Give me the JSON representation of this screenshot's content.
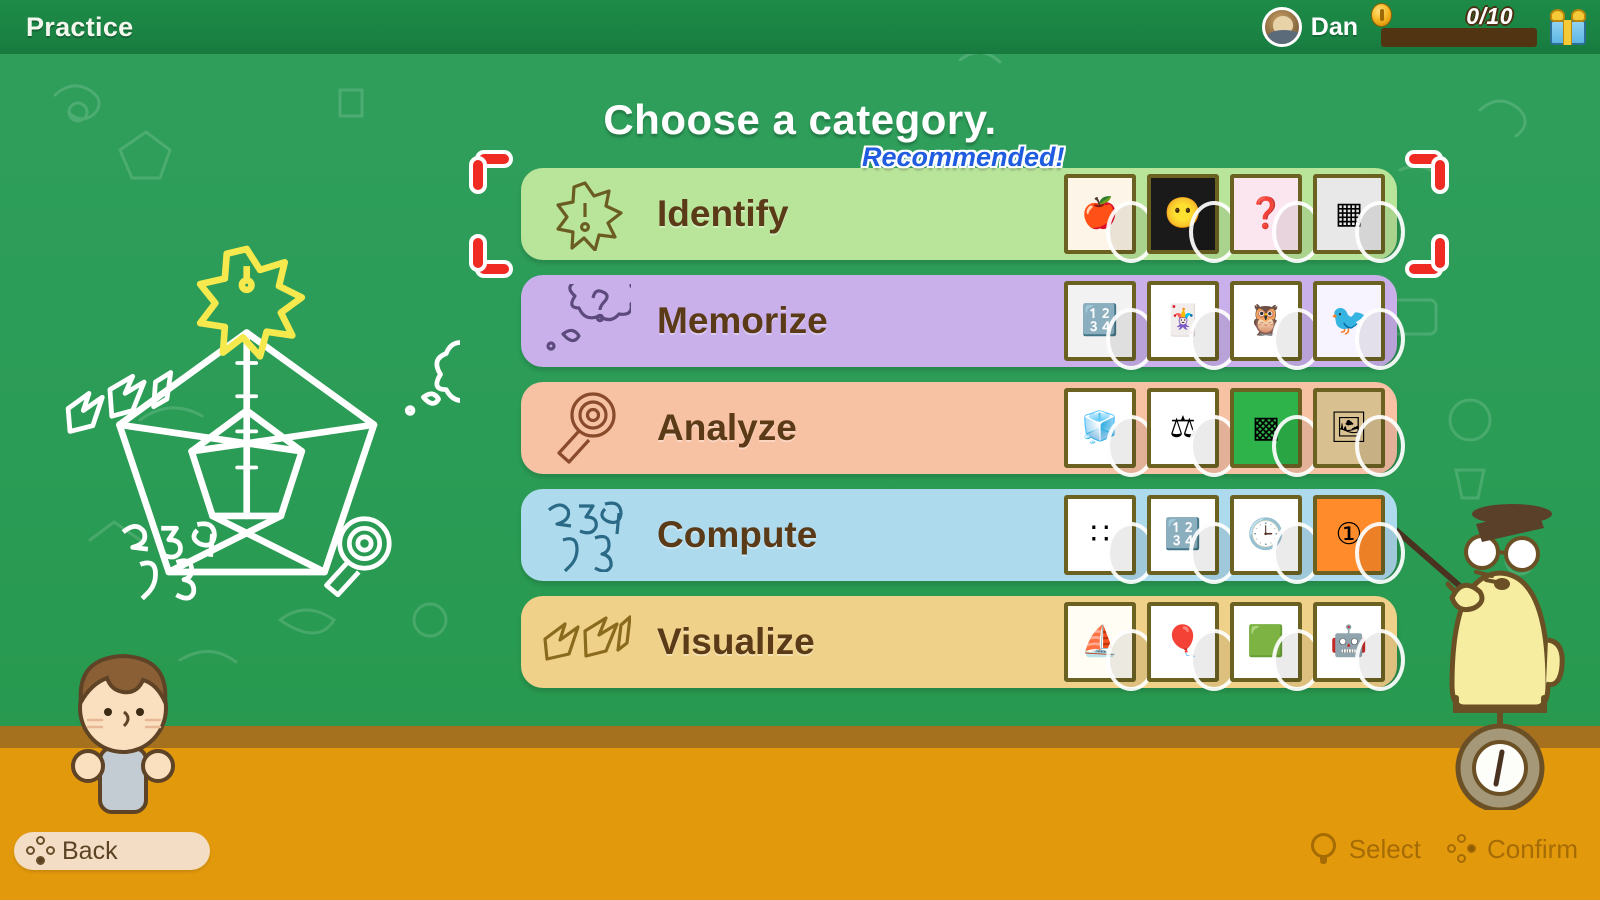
{
  "header": {
    "page_title": "Practice",
    "username": "Dan",
    "progress_count": "0/10",
    "progress_percent": 0,
    "avatar_icon": "user-avatar-icon",
    "coin_icon": "coin-icon",
    "gift_icon": "gift-box-icon"
  },
  "main": {
    "title": "Choose a category.",
    "recommended_badge": "Recommended!",
    "selected_category": "Identify"
  },
  "categories": [
    {
      "label": "Identify",
      "icon": "star-exclamation-icon",
      "color": "#b9e59a",
      "selected": true,
      "recommended": true,
      "thumbs": [
        {
          "name": "apple-food-thumbnail",
          "glyph": "🍎",
          "bg": "#fdf6e8"
        },
        {
          "name": "blurred-face-thumbnail",
          "glyph": "😶",
          "bg": "#1a1a1a"
        },
        {
          "name": "question-mark-stars-thumbnail",
          "glyph": "❓",
          "bg": "#fbe6f0"
        },
        {
          "name": "pixelated-photo-thumbnail",
          "glyph": "▦",
          "bg": "#e8e8e8"
        }
      ]
    },
    {
      "label": "Memorize",
      "icon": "thought-bubble-question-icon",
      "color": "#c9b0ea",
      "selected": false,
      "recommended": false,
      "thumbs": [
        {
          "name": "calculator-keypad-thumbnail",
          "glyph": "🔢",
          "bg": "#f2f2f2"
        },
        {
          "name": "card-match-thumbnail",
          "glyph": "🃏",
          "bg": "#ffffff"
        },
        {
          "name": "animal-faces-thumbnail",
          "glyph": "🦉",
          "bg": "#ffffff"
        },
        {
          "name": "birdcage-thumbnail",
          "glyph": "🐦",
          "bg": "#f7f3ff"
        }
      ]
    },
    {
      "label": "Analyze",
      "icon": "magnifying-glass-icon",
      "color": "#f7c1a4",
      "selected": false,
      "recommended": false,
      "thumbs": [
        {
          "name": "block-stack-thumbnail",
          "glyph": "🧊",
          "bg": "#ffffff"
        },
        {
          "name": "balance-scale-thumbnail",
          "glyph": "⚖",
          "bg": "#ffffff"
        },
        {
          "name": "maze-puzzle-thumbnail",
          "glyph": "▩",
          "bg": "#2db34a"
        },
        {
          "name": "photo-grid-thumbnail",
          "glyph": "🖼",
          "bg": "#d8c090"
        }
      ]
    },
    {
      "label": "Compute",
      "icon": "numbers-icon",
      "color": "#aedaee",
      "selected": false,
      "recommended": false,
      "thumbs": [
        {
          "name": "counting-dots-thumbnail",
          "glyph": "∷",
          "bg": "#ffffff"
        },
        {
          "name": "number-blocks-thumbnail",
          "glyph": "🔢",
          "bg": "#ffffff"
        },
        {
          "name": "analog-clock-thumbnail",
          "glyph": "🕒",
          "bg": "#ffffff"
        },
        {
          "name": "colored-numbers-thumbnail",
          "glyph": "①",
          "bg": "#ff8b2b"
        }
      ]
    },
    {
      "label": "Visualize",
      "icon": "motion-lines-icon",
      "color": "#f0d189",
      "selected": false,
      "recommended": false,
      "thumbs": [
        {
          "name": "origami-boat-thumbnail",
          "glyph": "⛵",
          "bg": "#fffdf4"
        },
        {
          "name": "balloons-thumbnail",
          "glyph": "🎈",
          "bg": "#ffffff"
        },
        {
          "name": "pipe-route-thumbnail",
          "glyph": "🟩",
          "bg": "#ffffff"
        },
        {
          "name": "robot-block-thumbnail",
          "glyph": "🤖",
          "bg": "#ffffff"
        }
      ]
    }
  ],
  "footer": {
    "back_label": "Back",
    "select_label": "Select",
    "confirm_label": "Confirm",
    "back_icon": "b-button-icon",
    "select_icon": "stick-icon",
    "confirm_icon": "a-button-icon"
  },
  "colors": {
    "board_green": "#2c9d58",
    "header_green": "#1a8243",
    "floor_orange": "#e3990c",
    "ledge_brown": "#a5711f",
    "selection_red": "#ef2b24",
    "recommended_blue": "#1f5ce0",
    "label_brown": "#5a3a17"
  },
  "radar": {
    "name": "skill-pentagon-chart",
    "points": [
      "Identify",
      "Memorize",
      "Analyze",
      "Compute",
      "Visualize"
    ]
  }
}
